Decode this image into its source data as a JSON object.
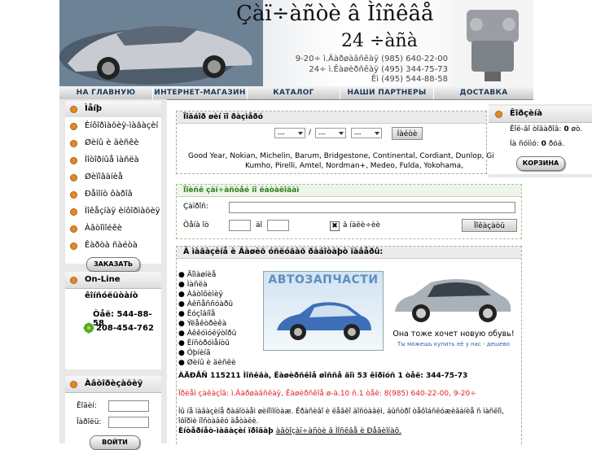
{
  "header": {
    "title": "Çàï÷àñòè â Ìîñêâå",
    "hours": "24 ÷àñà",
    "phones": [
      "9-20÷ ì.Âàðøàâñêàÿ (985) 640-22-00",
      "24÷ ì.Êàøèðñêàÿ (495) 344-75-73",
      "Êì (495) 544-88-58"
    ]
  },
  "nav": {
    "items": [
      "НА ГЛАВНУЮ",
      "ИНТЕРНЕТ-МАГАЗИН",
      "КАТАЛОГ",
      "НАШИ ПАРТНЕРЫ",
      "ДОСТАВКА"
    ]
  },
  "sidebar": {
    "menu": [
      "Ìåíþ",
      "Èíôîðìàöèÿ-ìàãàçèí",
      "Øèíû è äèñêè",
      "Ìîòîðíûå ìàñëà",
      "Øèïîâàíèå",
      "Ðåìîíò ôàðîâ",
      "Ìîêåçíàÿ èíôîðìàöèÿ",
      "Àâòîìîéêè",
      "Êàðòà ñàéòà"
    ],
    "order_button": "ЗАКАЗАТЬ",
    "online_title": "On-Line êîíñóëüòàíò",
    "phone1": "Òåë: 544-88-58",
    "phone2": "208-454-762",
    "auth_title": "Àâòîðèçàöèÿ",
    "login_label": "Ëîãèí:",
    "password_label": "Ïàðîëü:",
    "login_button": "ВОЙТИ"
  },
  "cart": {
    "title": "Êîðçèíà",
    "items_label": "Êîë-âî òîâàðîâ:",
    "items_value": "0",
    "sum_label": "Íà ñóììó:",
    "sum_value": "0",
    "items_unit": "øò.",
    "sum_unit": "ðóá.",
    "button": "КОРЗИНА"
  },
  "tire_search": {
    "title": "Ïîäáîð øèí ïî ðàçìåðó",
    "select1": "---",
    "select2": "---",
    "select3": "---",
    "separator": "/",
    "button": "Íàéòè",
    "brands_line1": "Good Year, Nokian, Michelin, Barum, Bridgestone, Continental, Cordiant, Dunlop, Gi",
    "brands_line2": "Kumho, Pirelli, Amtel, Nordman+, Medeo, Fulda, Yokohama,"
  },
  "parts_search": {
    "title": "Ïîèñê çàï÷àñòåé ïî êàòàëîãàì",
    "part_label": "Çàïðîñ:",
    "price_label": "Öåíà îò",
    "to_label": "äî",
    "check_label": "â íàëè÷èè",
    "button": "Ïîêàçàòü",
    "checked": true
  },
  "welcome": {
    "title": "Â ìàãàçèíå è Âàøèõ óñëóãàõ ðàáîòàþò ïàâåðû:",
    "list": [
      "Äîìàøíèå",
      "Ìàñëà",
      "Àâòîõèìèÿ",
      "Àêñåññóàðû",
      "Êóçîâíîå",
      "Ýëåêòðèêà",
      "Àêêóìóëÿòîðû",
      "Èíñòðóìåíòû",
      "Òþíèíã",
      "Øèíû è äèñêè"
    ],
    "banner1_text": "АВТОЗАПЧАСТИ",
    "banner2_caption": "Она тоже хочет новую обувь!",
    "banner2_sub": "Ты можешь купить её у нас - дешево",
    "address": "ÀÄÐÅÑ 115211 Ìîñêâà, Êàøèðñêîå øîññå äîì 53 êîðïóñ 1   òåë: 344-75-73",
    "red_line": "Ïðèåì çàêàçîâ: ì.Âàðøàâñêàÿ, Êàøèðñêîå ø-à.10 ñ.1 òåë: 8(985) 640-22-00, 9-20÷",
    "paragraph": "Ìû íå ìàãàçèíå ðàáîòàåì øèíîìîíòàæ. Êðàñèâî è ëåãêî äîñòàâèì, áûñòðî òåõîáñëóæèâàíèå ñ ìàñëîì,",
    "paragraph2": "îôîðìè ïîñòàâêó äåòàëè.",
    "footer_bold": "Èíòåðíåò-ìàãàçèí ïðîäàþ",
    "footer_link": "àâòîçàï÷àñòè â Ìîñêâå è Ðåãèîíàõ."
  },
  "colors": {
    "nav_text": "#1b3a5a",
    "green_title": "#2e7d1e",
    "red_text": "#e02020",
    "bullet_orange": "#e08a2b"
  }
}
